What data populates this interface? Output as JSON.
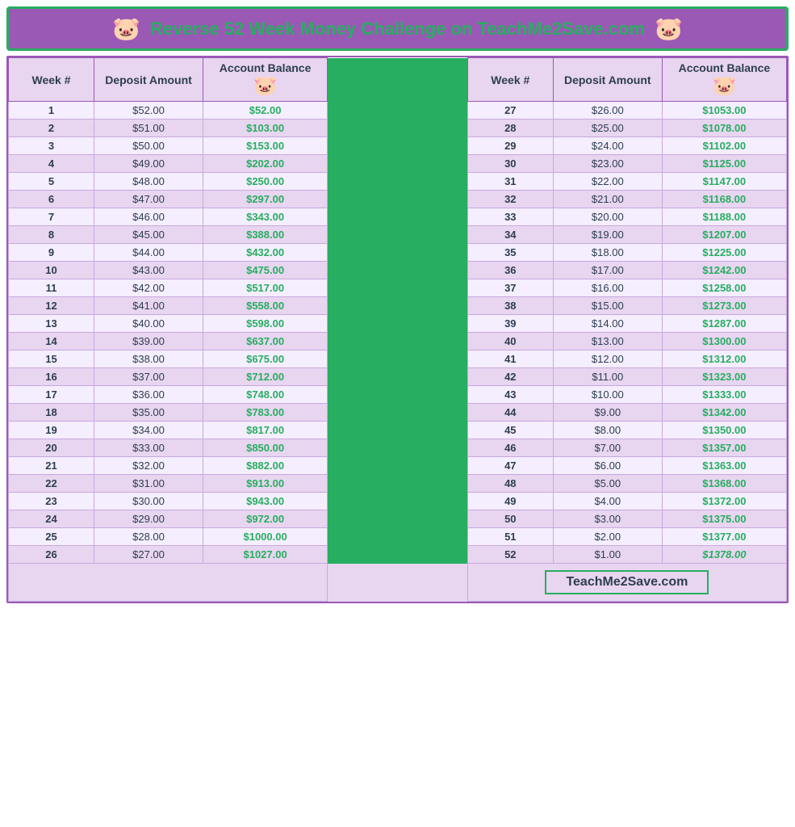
{
  "header": {
    "title": "Reverse 52 Week Money Challenge on TeachMe2Save.com",
    "pig_icon": "🐷"
  },
  "columns": {
    "left": {
      "week": "Week #",
      "deposit": "Deposit Amount",
      "balance": "Account Balance"
    },
    "right": {
      "week": "Week #",
      "deposit": "Deposit Amount",
      "balance": "Account Balance"
    }
  },
  "footer": {
    "brand": "TeachMe2Save.com"
  },
  "rows_left": [
    {
      "week": "1",
      "deposit": "$52.00",
      "balance": "$52.00"
    },
    {
      "week": "2",
      "deposit": "$51.00",
      "balance": "$103.00"
    },
    {
      "week": "3",
      "deposit": "$50.00",
      "balance": "$153.00"
    },
    {
      "week": "4",
      "deposit": "$49.00",
      "balance": "$202.00"
    },
    {
      "week": "5",
      "deposit": "$48.00",
      "balance": "$250.00"
    },
    {
      "week": "6",
      "deposit": "$47.00",
      "balance": "$297.00"
    },
    {
      "week": "7",
      "deposit": "$46.00",
      "balance": "$343.00"
    },
    {
      "week": "8",
      "deposit": "$45.00",
      "balance": "$388.00"
    },
    {
      "week": "9",
      "deposit": "$44.00",
      "balance": "$432.00"
    },
    {
      "week": "10",
      "deposit": "$43.00",
      "balance": "$475.00"
    },
    {
      "week": "11",
      "deposit": "$42.00",
      "balance": "$517.00"
    },
    {
      "week": "12",
      "deposit": "$41.00",
      "balance": "$558.00"
    },
    {
      "week": "13",
      "deposit": "$40.00",
      "balance": "$598.00"
    },
    {
      "week": "14",
      "deposit": "$39.00",
      "balance": "$637.00"
    },
    {
      "week": "15",
      "deposit": "$38.00",
      "balance": "$675.00"
    },
    {
      "week": "16",
      "deposit": "$37.00",
      "balance": "$712.00"
    },
    {
      "week": "17",
      "deposit": "$36.00",
      "balance": "$748.00"
    },
    {
      "week": "18",
      "deposit": "$35.00",
      "balance": "$783.00"
    },
    {
      "week": "19",
      "deposit": "$34.00",
      "balance": "$817.00"
    },
    {
      "week": "20",
      "deposit": "$33.00",
      "balance": "$850.00"
    },
    {
      "week": "21",
      "deposit": "$32.00",
      "balance": "$882.00"
    },
    {
      "week": "22",
      "deposit": "$31.00",
      "balance": "$913.00"
    },
    {
      "week": "23",
      "deposit": "$30.00",
      "balance": "$943.00"
    },
    {
      "week": "24",
      "deposit": "$29.00",
      "balance": "$972.00"
    },
    {
      "week": "25",
      "deposit": "$28.00",
      "balance": "$1000.00"
    },
    {
      "week": "26",
      "deposit": "$27.00",
      "balance": "$1027.00"
    }
  ],
  "rows_right": [
    {
      "week": "27",
      "deposit": "$26.00",
      "balance": "$1053.00"
    },
    {
      "week": "28",
      "deposit": "$25.00",
      "balance": "$1078.00"
    },
    {
      "week": "29",
      "deposit": "$24.00",
      "balance": "$1102.00"
    },
    {
      "week": "30",
      "deposit": "$23.00",
      "balance": "$1125.00"
    },
    {
      "week": "31",
      "deposit": "$22.00",
      "balance": "$1147.00"
    },
    {
      "week": "32",
      "deposit": "$21.00",
      "balance": "$1168.00"
    },
    {
      "week": "33",
      "deposit": "$20.00",
      "balance": "$1188.00"
    },
    {
      "week": "34",
      "deposit": "$19.00",
      "balance": "$1207.00"
    },
    {
      "week": "35",
      "deposit": "$18.00",
      "balance": "$1225.00"
    },
    {
      "week": "36",
      "deposit": "$17.00",
      "balance": "$1242.00"
    },
    {
      "week": "37",
      "deposit": "$16.00",
      "balance": "$1258.00"
    },
    {
      "week": "38",
      "deposit": "$15.00",
      "balance": "$1273.00"
    },
    {
      "week": "39",
      "deposit": "$14.00",
      "balance": "$1287.00"
    },
    {
      "week": "40",
      "deposit": "$13.00",
      "balance": "$1300.00"
    },
    {
      "week": "41",
      "deposit": "$12.00",
      "balance": "$1312.00"
    },
    {
      "week": "42",
      "deposit": "$11.00",
      "balance": "$1323.00"
    },
    {
      "week": "43",
      "deposit": "$10.00",
      "balance": "$1333.00"
    },
    {
      "week": "44",
      "deposit": "$9.00",
      "balance": "$1342.00"
    },
    {
      "week": "45",
      "deposit": "$8.00",
      "balance": "$1350.00"
    },
    {
      "week": "46",
      "deposit": "$7.00",
      "balance": "$1357.00"
    },
    {
      "week": "47",
      "deposit": "$6.00",
      "balance": "$1363.00"
    },
    {
      "week": "48",
      "deposit": "$5.00",
      "balance": "$1368.00"
    },
    {
      "week": "49",
      "deposit": "$4.00",
      "balance": "$1372.00"
    },
    {
      "week": "50",
      "deposit": "$3.00",
      "balance": "$1375.00"
    },
    {
      "week": "51",
      "deposit": "$2.00",
      "balance": "$1377.00"
    },
    {
      "week": "52",
      "deposit": "$1.00",
      "balance": "$1378.00"
    }
  ]
}
